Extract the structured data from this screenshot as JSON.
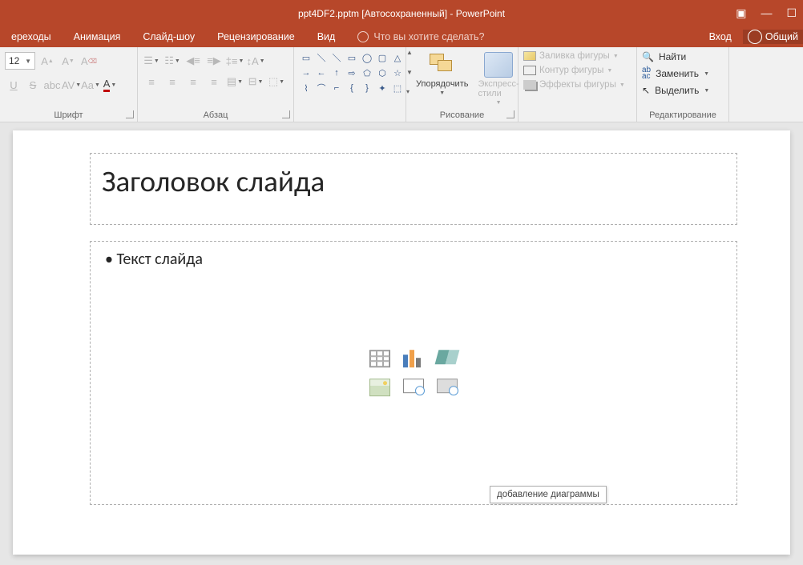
{
  "titlebar": {
    "title": "ppt4DF2.pptm [Автосохраненный] - PowerPoint"
  },
  "tabs": {
    "transitions": "ереходы",
    "animation": "Анимация",
    "slideshow": "Слайд-шоу",
    "review": "Рецензирование",
    "view": "Вид",
    "tellme": "Что вы хотите сделать?",
    "signin": "Вход",
    "share": "Общий"
  },
  "ribbon": {
    "font": {
      "label": "Шрифт",
      "size": "12"
    },
    "paragraph": {
      "label": "Абзац"
    },
    "drawing": {
      "label": "Рисование",
      "arrange": "Упорядочить",
      "styles": "Экспресс-стили",
      "fill": "Заливка фигуры",
      "outline": "Контур фигуры",
      "effects": "Эффекты фигуры"
    },
    "editing": {
      "label": "Редактирование",
      "find": "Найти",
      "replace": "Заменить",
      "select": "Выделить"
    }
  },
  "slide": {
    "title": "Заголовок слайда",
    "content": "Текст слайда"
  },
  "tooltip": "добавление диаграммы"
}
